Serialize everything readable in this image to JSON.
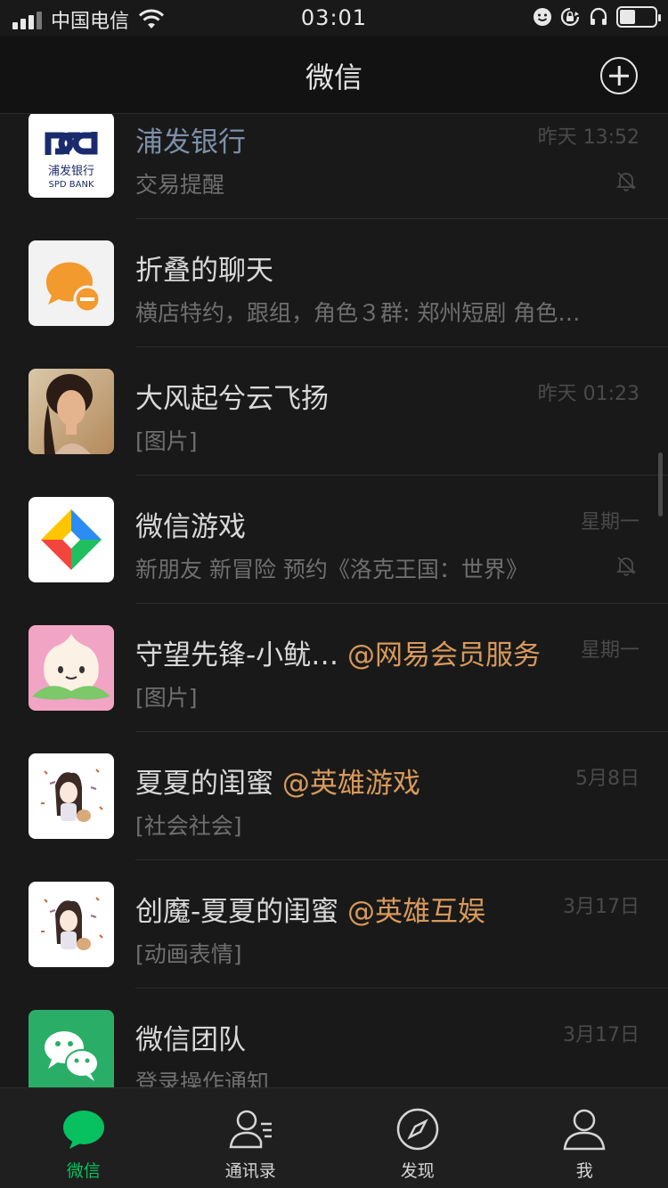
{
  "status_bar": {
    "carrier": "中国电信",
    "time": "03:01"
  },
  "nav": {
    "title": "微信"
  },
  "chats": [
    {
      "name": "浦发银行",
      "mention": "",
      "preview": "交易提醒",
      "time": "昨天 13:52",
      "muted": true,
      "avatar": "spd-bank-logo"
    },
    {
      "name": "折叠的聊天",
      "mention": "",
      "preview": "横店特约，跟组，角色３群: 郑州短剧 角色…",
      "time": "",
      "muted": false,
      "avatar": "folded-chats-icon"
    },
    {
      "name": "大风起兮云飞扬",
      "mention": "",
      "preview": "[图片]",
      "time": "昨天 01:23",
      "muted": false,
      "avatar": "portrait-photo"
    },
    {
      "name": "微信游戏",
      "mention": "",
      "preview": "新朋友 新冒险 预约《洛克王国：世界》",
      "time": "星期一",
      "muted": true,
      "avatar": "wechat-games-logo"
    },
    {
      "name": "守望先锋-小鱿…",
      "mention": "@网易会员服务",
      "preview": "[图片]",
      "time": "星期一",
      "muted": false,
      "avatar": "pachimari-avatar"
    },
    {
      "name": "夏夏的闺蜜",
      "mention": "@英雄游戏",
      "preview": "[社会社会]",
      "time": "5月8日",
      "muted": false,
      "avatar": "cartoon-girl-avatar"
    },
    {
      "name": "创魔-夏夏的闺蜜",
      "mention": "@英雄互娱",
      "preview": "[动画表情]",
      "time": "3月17日",
      "muted": false,
      "avatar": "cartoon-girl-avatar"
    },
    {
      "name": "微信团队",
      "mention": "",
      "preview": "登录操作通知",
      "time": "3月17日",
      "muted": false,
      "avatar": "wechat-team-logo"
    }
  ],
  "tabs": [
    {
      "label": "微信",
      "icon": "chat-bubble-icon",
      "active": true
    },
    {
      "label": "通讯录",
      "icon": "contacts-icon",
      "active": false
    },
    {
      "label": "发现",
      "icon": "compass-icon",
      "active": false
    },
    {
      "label": "我",
      "icon": "person-icon",
      "active": false
    }
  ],
  "colors": {
    "accent": "#07c160",
    "mention": "#d89a5a",
    "bank_name": "#7d90a9",
    "background": "#191919"
  }
}
